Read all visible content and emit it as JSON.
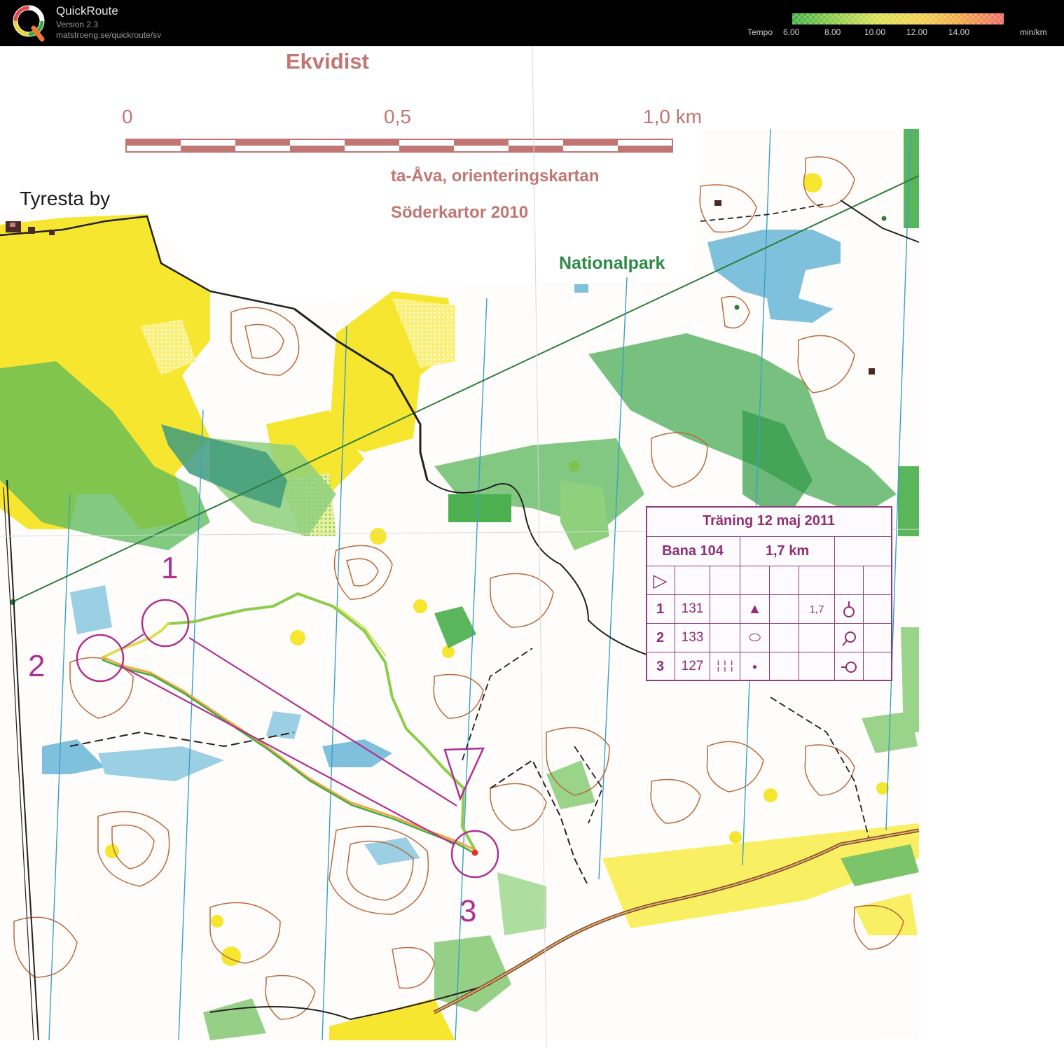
{
  "app": {
    "name": "QuickRoute",
    "version": "Version 2.3",
    "url": "matstroeng.se/quickroute/sv"
  },
  "tempo_scale": {
    "label": "Tempo",
    "ticks": [
      "6.00",
      "8.00",
      "10.00",
      "12.00",
      "14.00"
    ],
    "unit": "min/km",
    "colors": [
      "#3fae3f",
      "#8ccc4a",
      "#d8df52",
      "#f1d24c",
      "#f0a646",
      "#f06a63"
    ]
  },
  "map": {
    "header_text": "Ekvidist",
    "scale_bar": {
      "labels": [
        "0",
        "0,5",
        "1,0 km"
      ]
    },
    "credit_line_1": "ta-Åva, orienteringskartan",
    "credit_line_2": "Söderkartor 2010",
    "place_tyresta": "Tyresta by",
    "place_nationalpark": "Nationalpark",
    "course_color": "#b0308f",
    "route_colors": [
      "#3fae3f",
      "#8ccc4a",
      "#d8df52",
      "#f0a646"
    ],
    "controls": [
      {
        "number": "1"
      },
      {
        "number": "2"
      },
      {
        "number": "3"
      }
    ]
  },
  "control_description": {
    "title": "Träning 12 maj 2011",
    "course": "Bana 104",
    "length": "1,7 km",
    "start_symbol": "▷",
    "rows": [
      {
        "num": "1",
        "code": "131",
        "col_c": "",
        "symbol": "▲",
        "dim": "1,7",
        "loc": "ọ"
      },
      {
        "num": "2",
        "code": "133",
        "col_c": "",
        "symbol": "⬭",
        "dim": "",
        "loc": "ọ"
      },
      {
        "num": "3",
        "code": "127",
        "col_c": "╎╎╎",
        "symbol": "●",
        "dim": "",
        "loc": "ọ"
      }
    ]
  }
}
